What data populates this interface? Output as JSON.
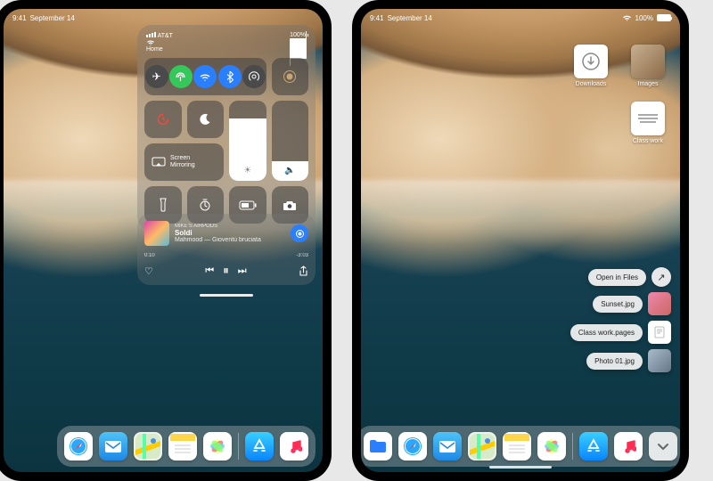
{
  "left": {
    "status": {
      "time": "9:41",
      "date": "September 14"
    },
    "cc_status": {
      "carrier": "AT&T",
      "wifi": "Home",
      "battery_pct": "100%"
    },
    "conn": {
      "airplane": {
        "on": false,
        "bg": "#4a4a4a"
      },
      "cellular": {
        "on": true,
        "bg": "#34c759"
      },
      "wifi": {
        "on": true,
        "bg": "#2a7fff"
      },
      "bluetooth": {
        "on": true,
        "bg": "#2a7fff"
      },
      "airdrop": {
        "on": false,
        "bg": "#4a4a4a"
      }
    },
    "mirror_label": "Screen\nMirroring",
    "media": {
      "source": "Mike's AirPods",
      "title": "Soldi",
      "artist": "Mahmood",
      "album": "Gioventù bruciata",
      "elapsed": "0:10",
      "remaining": "-3:03"
    }
  },
  "right": {
    "status": {
      "time": "9:41",
      "date": "September 14",
      "battery_pct": "100%"
    },
    "desktop": {
      "downloads": "Downloads",
      "images": "Images",
      "classwork": "Class work"
    },
    "ctx": {
      "open": "Open in Files",
      "f1": "Sunset.jpg",
      "f2": "Class work.pages",
      "f3": "Photo 01.jpg"
    }
  },
  "apps": {
    "files": {
      "bg": "#ffffff",
      "fg": "#2a7fff"
    },
    "safari": {
      "bg": "#ffffff"
    },
    "mail": {
      "bg": "linear-gradient(#4fc3f7,#1e88e5)"
    },
    "maps": {
      "bg": "#f5f0e1"
    },
    "notes": {
      "bg": "#fff"
    },
    "photos": {
      "bg": "#fff"
    },
    "appstore": {
      "bg": "linear-gradient(#39d0ff,#0a84ff)"
    },
    "music": {
      "bg": "#fff"
    },
    "more": {
      "bg": "rgba(255,255,255,.85)",
      "fg": "#555"
    }
  }
}
